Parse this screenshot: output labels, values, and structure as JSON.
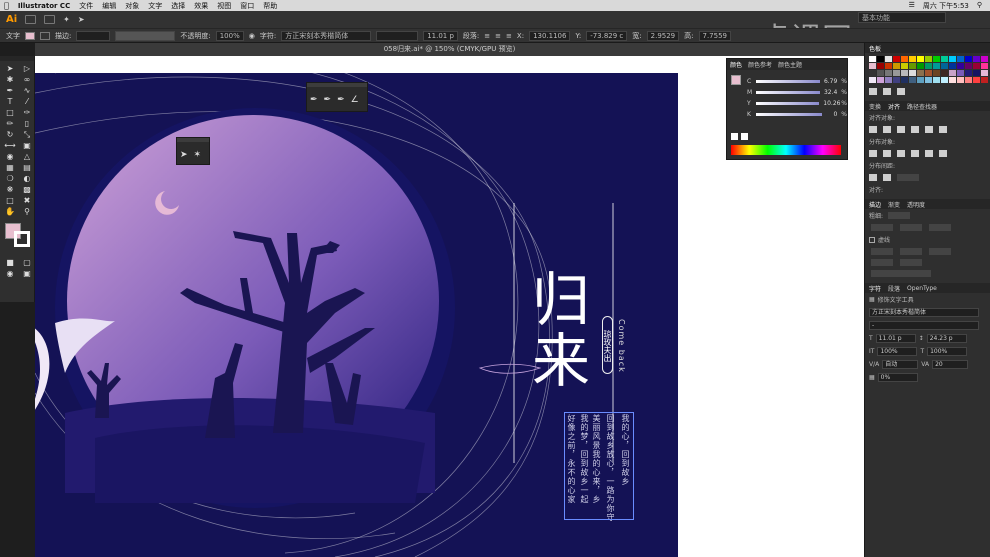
{
  "menubar": {
    "app_name": "Illustrator CC",
    "items": [
      "文件",
      "编辑",
      "对象",
      "文字",
      "选择",
      "效果",
      "视图",
      "窗口",
      "帮助"
    ],
    "clock": "周六 下午5:53"
  },
  "appbar": {
    "logo": "Ai",
    "workspace": "基本功能"
  },
  "watermark": "虎课网",
  "control_bar": {
    "mode_label": "文字",
    "stroke_label": "描边:",
    "opacity_label": "不透明度:",
    "opacity_value": "100%",
    "char_label": "字符:",
    "font_name": "方正宋刻本秀楷简体",
    "font_size": "11.01 p",
    "para_label": "段落:",
    "x_value": "130.1106",
    "y_value": "-73.829 c",
    "w_value": "2.9529",
    "h_value": "7.7559"
  },
  "document": {
    "tab_title": "058归来.ai* @ 150% (CMYK/GPU 预览)"
  },
  "artwork": {
    "title_char1": "归",
    "title_char2": "来",
    "subtitle_en": "Come back",
    "seal_text": "琼玫夫出",
    "poem_lines": [
      "我的心，回到故乡",
      "回到故乡放心，一路为你守",
      "美丽风景我的心来，乡",
      "我的梦，回到故乡一起",
      "好像之前，永不的心家"
    ]
  },
  "color_panel": {
    "tabs": [
      "颜色",
      "颜色参考",
      "颜色主题"
    ],
    "channels": [
      {
        "label": "C",
        "value": "6.79",
        "unit": "%"
      },
      {
        "label": "M",
        "value": "32.4",
        "unit": "%"
      },
      {
        "label": "Y",
        "value": "10.26",
        "unit": "%"
      },
      {
        "label": "K",
        "value": "0",
        "unit": "%"
      }
    ]
  },
  "right_panel": {
    "swatch_tab": "色板",
    "transform_tabs": [
      "变换",
      "对齐",
      "路径查找器"
    ],
    "align_objects": "对齐对象:",
    "distribute_objects": "分布对象:",
    "distribute_spacing": "分布间距:",
    "align_to": "对齐:",
    "stroke_tabs": [
      "描边",
      "渐变",
      "透明度"
    ],
    "stroke_weight": "粗细:",
    "path_section": "虚线",
    "char_tabs": [
      "字符",
      "段落",
      "OpenType"
    ],
    "touch_type_label": "修饰文字工具",
    "font_family": "方正宋刻本秀楷简体",
    "font_style": "-",
    "font_size": "11.01 p",
    "leading": "24.23 p",
    "h_scale": "100%",
    "v_scale": "100%",
    "kerning": "自动",
    "tracking": "20",
    "baseline": "0%"
  },
  "colors": {
    "art_bg": "#141255",
    "moon_ring": "#e6b9d6",
    "gradient_top": "#c79ad6",
    "gradient_bottom": "#2b1d7a",
    "accent": "#e8bfcf"
  }
}
